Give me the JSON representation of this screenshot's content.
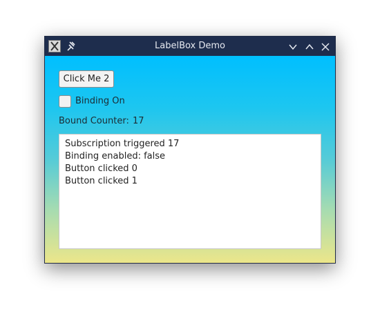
{
  "window": {
    "title": "LabelBox Demo",
    "app_icon": "x-window-icon",
    "controls": [
      "minimize-icon",
      "maximize-icon",
      "close-icon"
    ]
  },
  "main": {
    "button_label": "Click Me 2",
    "checkbox_label": "Binding On",
    "checkbox_checked": false,
    "counter_label": "Bound Counter:",
    "counter_value": "17",
    "log_lines": [
      "Subscription triggered 17",
      "Binding enabled: false",
      "Button clicked 0",
      "Button clicked 1"
    ]
  },
  "colors": {
    "titlebar": "#1e2d4d",
    "gradient_top": "#00bfff",
    "gradient_bottom": "#ece68a"
  }
}
